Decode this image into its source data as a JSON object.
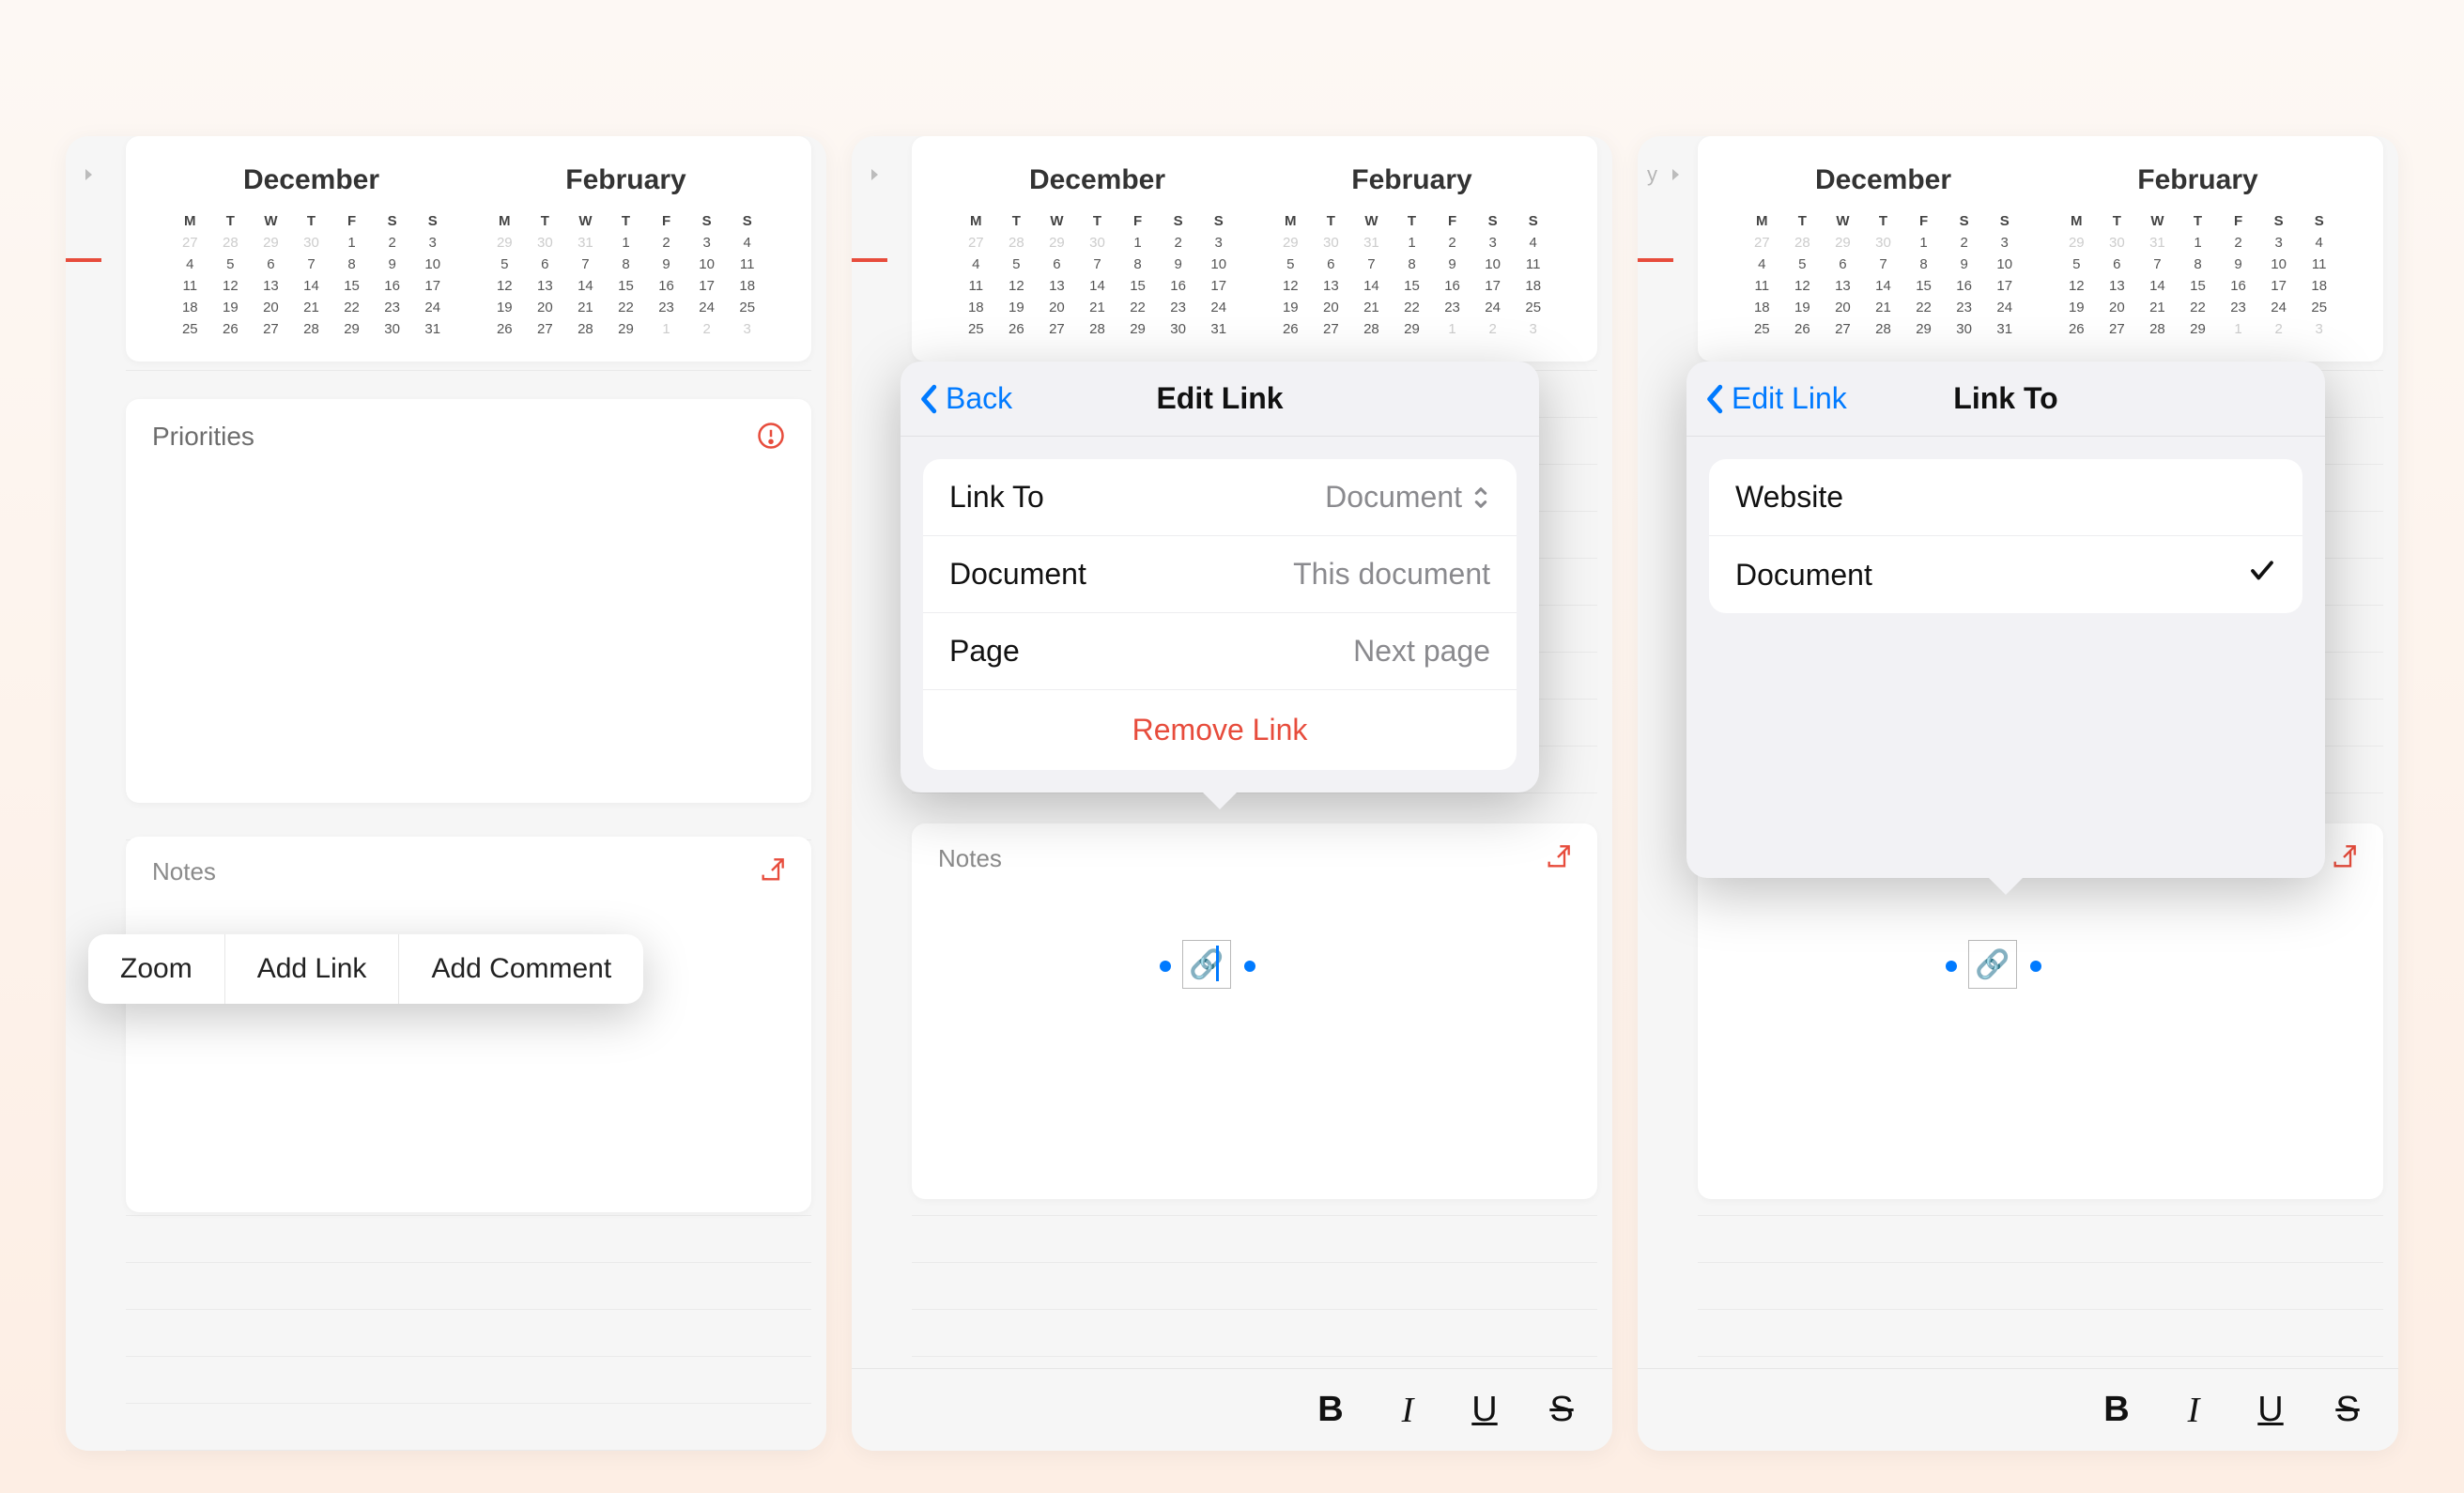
{
  "calendar": {
    "month1": {
      "title": "December",
      "days_header": [
        "M",
        "T",
        "W",
        "T",
        "F",
        "S",
        "S"
      ],
      "rows": [
        [
          {
            "v": "27",
            "f": true
          },
          {
            "v": "28",
            "f": true
          },
          {
            "v": "29",
            "f": true
          },
          {
            "v": "30",
            "f": true
          },
          {
            "v": "1"
          },
          {
            "v": "2"
          },
          {
            "v": "3"
          }
        ],
        [
          {
            "v": "4"
          },
          {
            "v": "5"
          },
          {
            "v": "6"
          },
          {
            "v": "7"
          },
          {
            "v": "8"
          },
          {
            "v": "9"
          },
          {
            "v": "10"
          }
        ],
        [
          {
            "v": "11"
          },
          {
            "v": "12"
          },
          {
            "v": "13"
          },
          {
            "v": "14"
          },
          {
            "v": "15"
          },
          {
            "v": "16"
          },
          {
            "v": "17"
          }
        ],
        [
          {
            "v": "18"
          },
          {
            "v": "19"
          },
          {
            "v": "20"
          },
          {
            "v": "21"
          },
          {
            "v": "22"
          },
          {
            "v": "23"
          },
          {
            "v": "24"
          }
        ],
        [
          {
            "v": "25"
          },
          {
            "v": "26"
          },
          {
            "v": "27"
          },
          {
            "v": "28"
          },
          {
            "v": "29"
          },
          {
            "v": "30"
          },
          {
            "v": "31"
          }
        ]
      ]
    },
    "month2": {
      "title": "February",
      "days_header": [
        "M",
        "T",
        "W",
        "T",
        "F",
        "S",
        "S"
      ],
      "rows": [
        [
          {
            "v": "29",
            "f": true
          },
          {
            "v": "30",
            "f": true
          },
          {
            "v": "31",
            "f": true
          },
          {
            "v": "1"
          },
          {
            "v": "2"
          },
          {
            "v": "3"
          },
          {
            "v": "4"
          }
        ],
        [
          {
            "v": "5"
          },
          {
            "v": "6"
          },
          {
            "v": "7"
          },
          {
            "v": "8"
          },
          {
            "v": "9"
          },
          {
            "v": "10"
          },
          {
            "v": "11"
          }
        ],
        [
          {
            "v": "12"
          },
          {
            "v": "13"
          },
          {
            "v": "14"
          },
          {
            "v": "15"
          },
          {
            "v": "16"
          },
          {
            "v": "17"
          },
          {
            "v": "18"
          }
        ],
        [
          {
            "v": "19"
          },
          {
            "v": "20"
          },
          {
            "v": "21"
          },
          {
            "v": "22"
          },
          {
            "v": "23"
          },
          {
            "v": "24"
          },
          {
            "v": "25"
          }
        ],
        [
          {
            "v": "26"
          },
          {
            "v": "27"
          },
          {
            "v": "28"
          },
          {
            "v": "29"
          },
          {
            "v": "1",
            "f": true
          },
          {
            "v": "2",
            "f": true
          },
          {
            "v": "3",
            "f": true
          }
        ]
      ]
    }
  },
  "priorities": {
    "title": "Priorities"
  },
  "notes": {
    "title": "Notes"
  },
  "context_menu": {
    "zoom": "Zoom",
    "add_link": "Add Link",
    "add_comment": "Add Comment"
  },
  "link_icon": "🔗",
  "edit_link_popover": {
    "back": "Back",
    "title": "Edit Link",
    "rows": {
      "link_to": {
        "label": "Link To",
        "value": "Document"
      },
      "document": {
        "label": "Document",
        "value": "This document"
      },
      "page": {
        "label": "Page",
        "value": "Next page"
      }
    },
    "remove": "Remove Link"
  },
  "link_to_popover": {
    "back": "Edit Link",
    "title": "Link To",
    "options": {
      "website": "Website",
      "document": "Document"
    },
    "selected": "document"
  },
  "peek_label": "y",
  "format": {
    "bold": "B",
    "italic": "I",
    "underline": "U",
    "strike": "S"
  }
}
